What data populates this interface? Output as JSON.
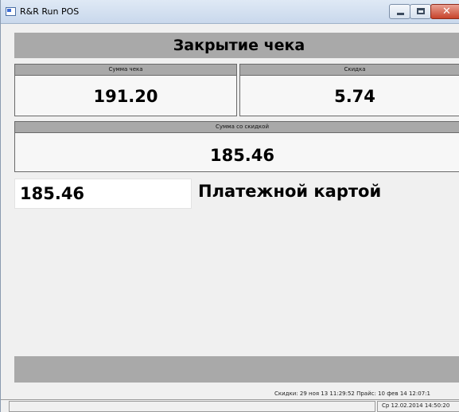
{
  "window": {
    "title": "R&R Run POS"
  },
  "header": {
    "title": "Закрытие чека"
  },
  "receipt_sum": {
    "label": "Сумма чека",
    "value": "191.20"
  },
  "discount": {
    "label": "Скидка",
    "value": "5.74"
  },
  "discounted_sum": {
    "label": "Сумма со скидкой",
    "value": "185.46"
  },
  "payment": {
    "amount": "185.46",
    "method": "Платежной картой"
  },
  "status": {
    "info": "Скидки: 29 ноя 13 11:29:52 Прайс: 10 фев 14 12:07:1",
    "datetime": "Ср 12.02.2014 14:50:20"
  },
  "icons": {
    "app": "app-icon",
    "minimize": "minimize-icon",
    "maximize": "maximize-icon",
    "close": "close-icon"
  }
}
